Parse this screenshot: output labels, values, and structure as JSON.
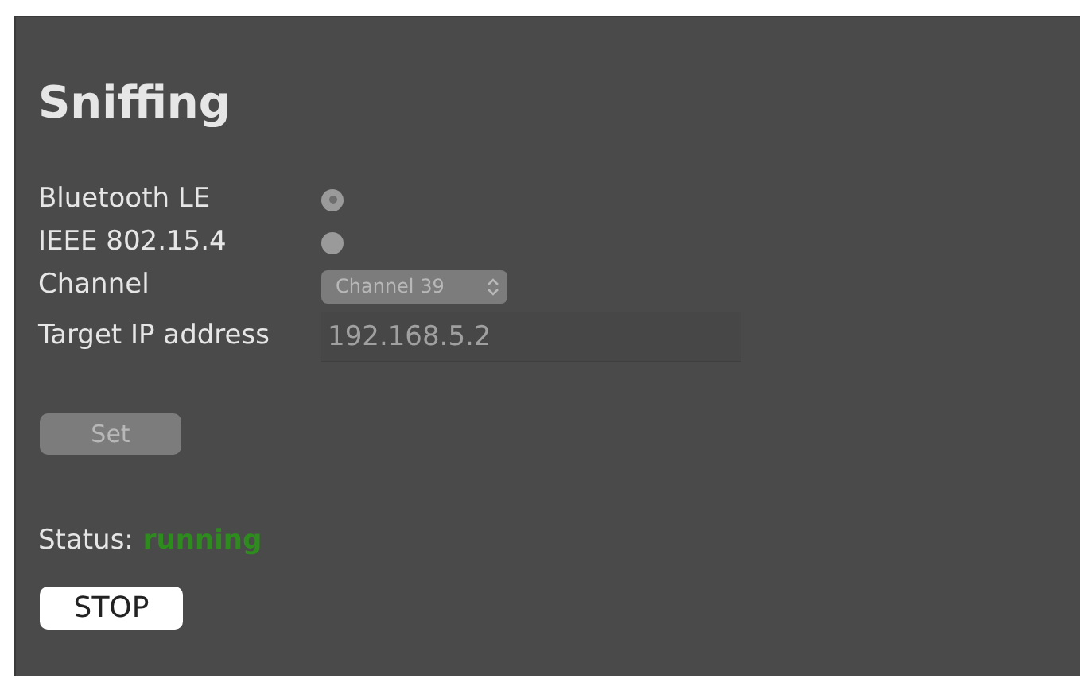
{
  "title": "Sniffing",
  "modes": [
    {
      "label": "Bluetooth LE",
      "selected": true,
      "disabled": true
    },
    {
      "label": "IEEE 802.15.4",
      "selected": false,
      "disabled": true
    }
  ],
  "channel": {
    "label": "Channel",
    "value": "Channel 39",
    "disabled": true
  },
  "target": {
    "label": "Target IP address",
    "value": "192.168.5.2"
  },
  "set_button": {
    "label": "Set",
    "disabled": true
  },
  "status": {
    "label": "Status:",
    "value": "running"
  },
  "stop_button": {
    "label": "STOP",
    "disabled": false
  }
}
